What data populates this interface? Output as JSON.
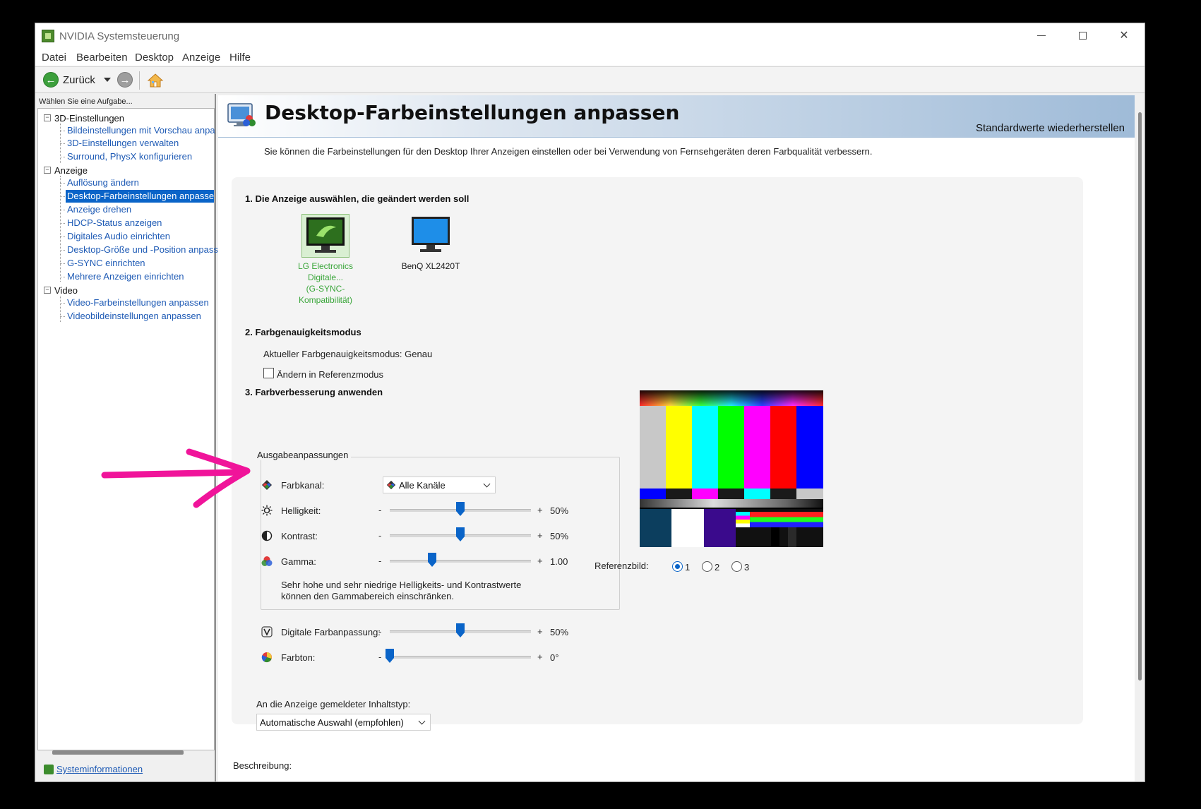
{
  "window": {
    "title": "NVIDIA Systemsteuerung",
    "controls": {
      "minimize": "",
      "maximize": "",
      "close": "✕"
    }
  },
  "menu": [
    "Datei",
    "Bearbeiten",
    "Desktop",
    "Anzeige",
    "Hilfe"
  ],
  "toolbar": {
    "back_label": "Zurück"
  },
  "sidebar": {
    "heading": "Wählen Sie eine Aufgabe...",
    "categories": [
      {
        "label": "3D-Einstellungen",
        "toggle": "−",
        "items": [
          "Bildeinstellungen mit Vorschau anpa",
          "3D-Einstellungen verwalten",
          "Surround, PhysX konfigurieren"
        ]
      },
      {
        "label": "Anzeige",
        "toggle": "−",
        "items": [
          "Auflösung ändern",
          "Desktop-Farbeinstellungen anpassen",
          "Anzeige drehen",
          "HDCP-Status anzeigen",
          "Digitales Audio einrichten",
          "Desktop-Größe und -Position anpass",
          "G-SYNC einrichten",
          "Mehrere Anzeigen einrichten"
        ]
      },
      {
        "label": "Video",
        "toggle": "−",
        "items": [
          "Video-Farbeinstellungen anpassen",
          "Videobildeinstellungen anpassen"
        ]
      }
    ],
    "selected_item": "Desktop-Farbeinstellungen anpassen",
    "footer_link": "Systeminformationen"
  },
  "page": {
    "title": "Desktop-Farbeinstellungen anpassen",
    "restore_defaults": "Standardwerte wiederherstellen",
    "intro": "Sie können die Farbeinstellungen für den Desktop Ihrer Anzeigen einstellen oder bei Verwendung von Fernsehgeräten deren Farbqualität verbessern.",
    "section1": {
      "title": "1. Die Anzeige auswählen, die geändert werden soll",
      "displays": [
        {
          "line1": "LG Electronics Digitale...",
          "line2": "(G-SYNC-Kompatibilität)",
          "selected": true
        },
        {
          "line1": "BenQ XL2420T",
          "line2": "",
          "selected": false
        }
      ]
    },
    "section2": {
      "title": "2. Farbgenauigkeitsmodus",
      "current_mode": "Aktueller Farbgenauigkeitsmodus: Genau",
      "reference_checkbox": "Ändern in Referenzmodus",
      "reference_checked": false
    },
    "section3": {
      "title": "3. Farbverbesserung anwenden",
      "group_label": "Ausgabeanpassungen",
      "channel_label": "Farbkanal:",
      "channel_value": "Alle Kanäle",
      "rows": [
        {
          "label": "Helligkeit:",
          "minus": "-",
          "plus": "+",
          "value": "50%",
          "level": 0.5
        },
        {
          "label": "Kontrast:",
          "minus": "-",
          "plus": "+",
          "value": "50%",
          "level": 0.5
        },
        {
          "label": "Gamma:",
          "minus": "-",
          "plus": "+",
          "value": "1.00",
          "level": 0.3
        }
      ],
      "note_line1": "Sehr hohe und sehr niedrige Helligkeits- und Kontrastwerte",
      "note_line2": "können den Gammabereich einschränken.",
      "extra_rows": [
        {
          "label": "Digitale Farbanpassung:",
          "minus": "-",
          "plus": "+",
          "value": "50%",
          "level": 0.5
        },
        {
          "label": "Farbton:",
          "minus": "-",
          "plus": "+",
          "value": "0°",
          "level": 0.0
        }
      ],
      "reference_label": "Referenzbild:",
      "reference_options": [
        "1",
        "2",
        "3"
      ],
      "reference_selected": "1"
    },
    "content_type_label": "An die Anzeige gemeldeter Inhaltstyp:",
    "content_type_value": "Automatische Auswahl (empfohlen)",
    "description_label": "Beschreibung:"
  },
  "colors": {
    "accent": "#0a64c8",
    "link": "#1f5bb5",
    "active_display": "#3aa63a",
    "annotation_arrow": "#f0149a"
  }
}
